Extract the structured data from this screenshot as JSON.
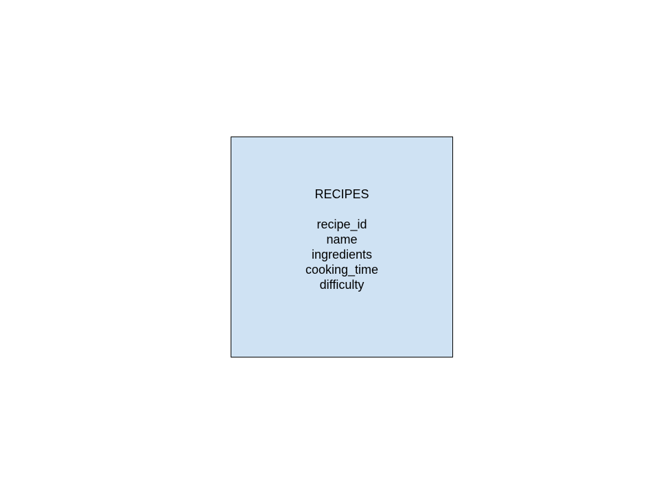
{
  "entity": {
    "title": "RECIPES",
    "fill_color": "#cfe2f3",
    "border_color": "#000000",
    "attributes": [
      "recipe_id",
      "name",
      "ingredients",
      "cooking_time",
      "difficulty"
    ]
  }
}
